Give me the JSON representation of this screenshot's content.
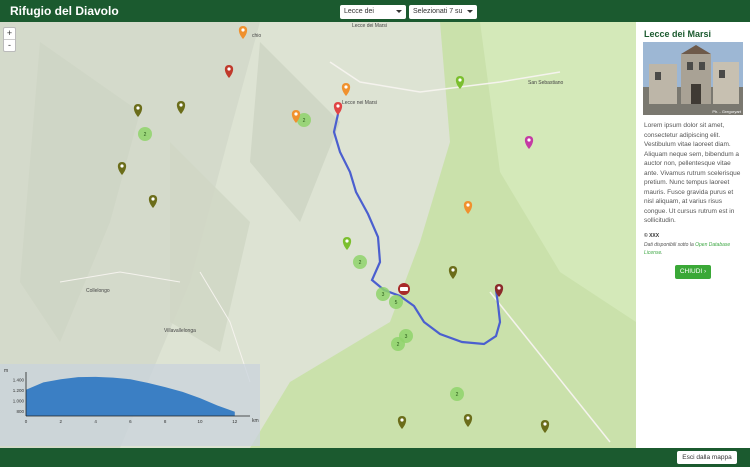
{
  "header": {
    "title": "Rifugio del Diavolo",
    "location_select": "Lecce dei Marsi",
    "filter_select": "Selezionati 7 su 7"
  },
  "map": {
    "zoom_in": "+",
    "zoom_out": "-",
    "labels": {
      "town_center": "Lecce nei Marsi",
      "town_nw": "chio",
      "town_ne": "San Sebastiano",
      "town_w": "Collelongo",
      "town_sw": "Villavallelonga",
      "town_top": "Lecce dei Marsi"
    },
    "cluster_counts": [
      "2",
      "2",
      "3",
      "5",
      "3",
      "2",
      "2",
      "2"
    ]
  },
  "elevation_chart": {
    "y_unit": "m",
    "x_unit": "km",
    "y_ticks": [
      "1.400",
      "1.200",
      "1.000",
      "800"
    ],
    "x_ticks": [
      "0",
      "2",
      "4",
      "6",
      "8",
      "10",
      "12"
    ]
  },
  "chart_data": {
    "type": "area",
    "xlabel": "km",
    "ylabel": "m",
    "xlim": [
      0,
      13
    ],
    "ylim": [
      700,
      1500
    ],
    "x": [
      0,
      1,
      2,
      3,
      4,
      5,
      6,
      7,
      8,
      9,
      10,
      11,
      12
    ],
    "y": [
      1200,
      1340,
      1400,
      1440,
      1445,
      1430,
      1400,
      1330,
      1250,
      1160,
      1040,
      900,
      780
    ]
  },
  "sidebar": {
    "title": "Lecce dei Marsi",
    "photo_credit": "Ph. - Gregoryart",
    "description": "Lorem ipsum dolor sit amet, consectetur adipiscing elit. Vestibulum vitae laoreet diam. Aliquam neque sem, bibendum a auctor non, pellentesque vitae ante. Vivamus rutrum scelerisque pretium. Nunc tempus laoreet mauris. Fusce gravida purus et nisl aliquam, at varius risus congue. Ut cursus rutrum est in sollicitudin.",
    "copyright": "© XXX",
    "license_prefix": "Dati disponibili sotto la ",
    "license_link": "Open Database License",
    "license_suffix": ".",
    "close_label": "CHIUDI"
  },
  "footer": {
    "exit_label": "Esci dalla mappa"
  },
  "colors": {
    "brand": "#1b5a2f",
    "accent_green": "#3aa837",
    "route": "#4b5fcf",
    "marker_orange": "#f0912e",
    "marker_red": "#c0392b",
    "marker_olive": "#6b6d1a",
    "marker_green": "#7bbf2e",
    "marker_magenta": "#c43aa4",
    "cluster": "#8fd46b"
  },
  "icons": [
    "map-marker-icon",
    "chevron-right-icon",
    "caret-down-icon",
    "car-icon"
  ]
}
